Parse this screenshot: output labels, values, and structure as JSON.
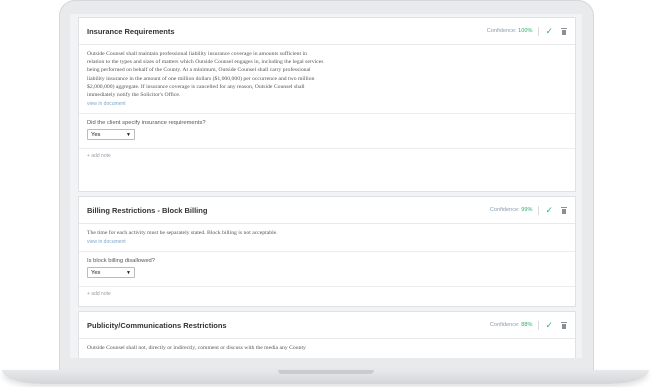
{
  "cards": [
    {
      "title": "Insurance Requirements",
      "confidence_label": "Confidence:",
      "confidence_value": "100%",
      "text_lines": [
        "Outside Counsel shall maintain professional liability insurance coverage in amounts sufficient in",
        "relation to the types and sizes of matters which Outside Counsel engages in, including the legal services",
        "being performed on behalf of the County. At a minimum, Outside Counsel shall carry professional",
        "liability insurance in the amount of one million dollars ($1,000,000) per occurrence and two million",
        "$2,000,000) aggregate. If insurance coverage is cancelled for any reason, Outside Counsel shall",
        "immediately notify the Solicitor's Office."
      ],
      "view_link": "view in document",
      "question": "Did the client specify insurance requirements?",
      "answer": "Yes",
      "add_note": "+ add note"
    },
    {
      "title": "Billing Restrictions - Block Billing",
      "confidence_label": "Confidence:",
      "confidence_value": "99%",
      "text_lines": [
        "The time for each activity must be separately stated. Block billing is not acceptable."
      ],
      "view_link": "view in document",
      "question": "Is block billing disallowed?",
      "answer": "Yes",
      "add_note": "+ add note"
    },
    {
      "title": "Publicity/Communications Restrictions",
      "confidence_label": "Confidence:",
      "confidence_value": "88%",
      "text_lines": [
        "Outside Counsel shall not, directly or indirectly, comment or discuss with the media any County"
      ]
    }
  ],
  "icons": {
    "approve": "check-icon",
    "delete": "trash-icon",
    "dropdown": "caret-down-icon"
  }
}
